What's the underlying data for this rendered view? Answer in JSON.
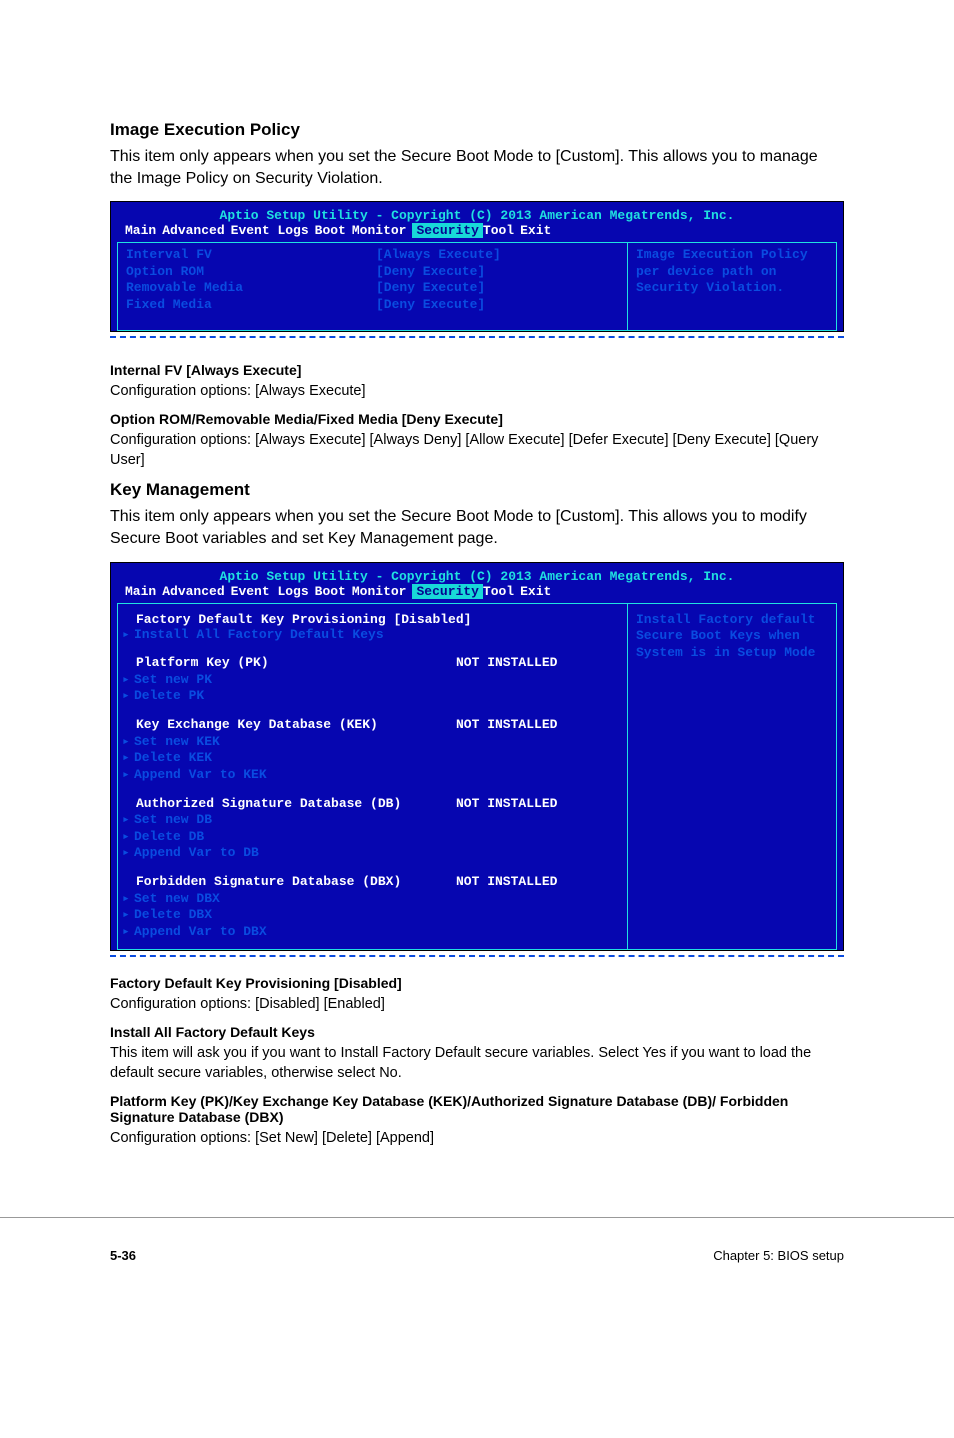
{
  "section1": {
    "heading": "Image Execution Policy",
    "desc": "This item only appears when you set the Secure Boot Mode to [Custom]. This allows you to manage the Image Policy on Security Violation."
  },
  "bios1": {
    "title": "Aptio Setup Utility - Copyright (C) 2013 American Megatrends, Inc.",
    "menu": [
      "Main",
      "Advanced",
      "Event Logs",
      "Boot",
      "Monitor",
      "Security",
      "Tool",
      "Exit"
    ],
    "rows": [
      {
        "label": "Interval FV",
        "value": "[Always Execute]"
      },
      {
        "label": "Option ROM",
        "value": "[Deny Execute]"
      },
      {
        "label": "Removable Media",
        "value": "[Deny Execute]"
      },
      {
        "label": "Fixed Media",
        "value": "[Deny Execute]"
      }
    ],
    "help": "Image Execution Policy per device path on Security Violation."
  },
  "sub1": {
    "h": "Internal FV [Always Execute]",
    "p": "Configuration options: [Always Execute]"
  },
  "sub2": {
    "h": "Option ROM/Removable Media/Fixed Media [Deny Execute]",
    "p": "Configuration options: [Always Execute] [Always Deny] [Allow Execute] [Defer Execute] [Deny Execute] [Query User]"
  },
  "section2": {
    "heading": "Key Management",
    "desc": "This item only appears when you set the Secure Boot Mode to [Custom]. This allows you to modify Secure Boot variables and set Key Management page."
  },
  "bios2": {
    "title": "Aptio Setup Utility - Copyright (C) 2013 American Megatrends, Inc.",
    "menu": [
      "Main",
      "Advanced",
      "Event Logs",
      "Boot",
      "Monitor",
      "Security",
      "Tool",
      "Exit"
    ],
    "top_white": "Factory Default Key Provisioning [Disabled]",
    "install_all": "Install All Factory Default Keys",
    "blocks": [
      {
        "header_label": "Platform Key (PK)",
        "header_value": "NOT INSTALLED",
        "items": [
          "Set new PK",
          "Delete PK"
        ]
      },
      {
        "header_label": "Key Exchange Key Database (KEK)",
        "header_value": "NOT INSTALLED",
        "items": [
          "Set new KEK",
          "Delete KEK",
          "Append Var to KEK"
        ]
      },
      {
        "header_label": "Authorized Signature Database (DB)",
        "header_value": "NOT INSTALLED",
        "items": [
          "Set new DB",
          "Delete DB",
          "Append Var to DB"
        ]
      },
      {
        "header_label": "Forbidden Signature Database (DBX)",
        "header_value": "NOT INSTALLED",
        "items": [
          "Set new DBX",
          "Delete DBX",
          "Append Var to DBX"
        ]
      }
    ],
    "help": "Install Factory default Secure Boot Keys when System is in Setup Mode"
  },
  "sub3": {
    "h": "Factory Default Key Provisioning [Disabled]",
    "p": "Configuration options: [Disabled] [Enabled]"
  },
  "sub4": {
    "h": "Install All Factory Default Keys",
    "p": "This item will ask you if you want to Install Factory Default secure variables. Select Yes if you want to load the default secure variables, otherwise select No."
  },
  "sub5": {
    "h": "Platform Key (PK)/Key Exchange Key Database (KEK)/Authorized Signature Database (DB)/ Forbidden Signature Database (DBX)",
    "p": "Configuration options: [Set New] [Delete] [Append]"
  },
  "footer": {
    "left": "5-36",
    "right": "Chapter 5: BIOS setup"
  }
}
